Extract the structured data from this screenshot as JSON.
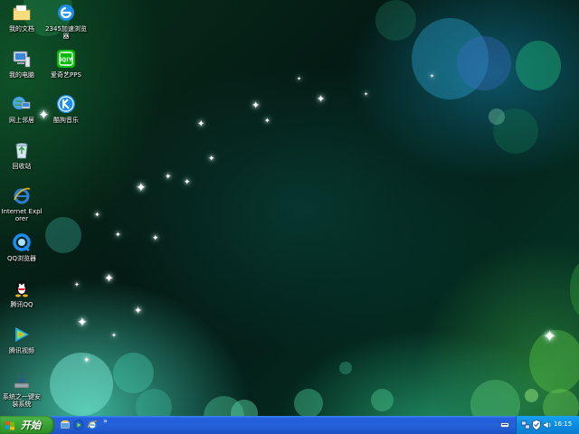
{
  "desktop": {
    "icons": [
      {
        "label": "我的文档",
        "icon": "my-documents-icon"
      },
      {
        "label": "2345加速浏览器",
        "icon": "2345-browser-icon"
      },
      {
        "label": "我的电脑",
        "icon": "my-computer-icon"
      },
      {
        "label": "爱奇艺PPS",
        "icon": "iqiyi-pps-icon"
      },
      {
        "label": "网上邻居",
        "icon": "network-places-icon"
      },
      {
        "label": "酷狗音乐",
        "icon": "kugou-music-icon"
      },
      {
        "label": "回收站",
        "icon": "recycle-bin-icon"
      },
      {
        "label": "Internet Explorer",
        "icon": "internet-explorer-icon"
      },
      {
        "label": "QQ浏览器",
        "icon": "qq-browser-icon"
      },
      {
        "label": "腾讯QQ",
        "icon": "tencent-qq-icon"
      },
      {
        "label": "腾讯视频",
        "icon": "tencent-video-icon"
      },
      {
        "label": "系统之一键安装系统",
        "icon": "system-installer-icon"
      }
    ]
  },
  "taskbar": {
    "start_label": "开始",
    "quick_launch": [
      "show-desktop-icon",
      "media-player-icon",
      "ie-quicklaunch-icon"
    ],
    "quick_launch_expand": "»",
    "tray": {
      "icons": [
        "network-icon",
        "security-shield-icon",
        "volume-icon"
      ],
      "clock": "16:15"
    }
  },
  "colors": {
    "taskbar_blue": "#245edc",
    "start_green": "#39a233",
    "tray_blue": "#0d8ce0"
  }
}
